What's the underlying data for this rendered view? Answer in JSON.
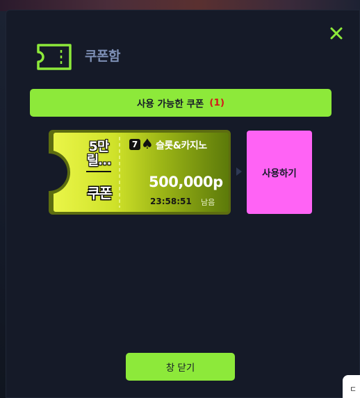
{
  "modal": {
    "title": "쿠폰함",
    "close_icon": "close-x-icon",
    "header_icon": "ticket-icon",
    "available": {
      "label": "사용 가능한 쿠폰",
      "count": "(1)"
    },
    "coupon": {
      "name": "5만 릴…",
      "type_label": "쿠폰",
      "brand_badge": "7",
      "brand_icon": "spade-icon",
      "brand_name": "슬롯&카지노",
      "amount": "500,000p",
      "time_left": "23:58:51",
      "remaining_label": "남음",
      "use_button": "사용하기"
    },
    "close_button": "창 닫기"
  },
  "corner_widget": {
    "text": "ㄷ"
  },
  "colors": {
    "accent_green": "#8de93a",
    "use_button_pink": "#ff63f5",
    "count_red": "#d41a1a",
    "modal_bg": "#151a28",
    "title_blue": "#7d8fb5"
  }
}
